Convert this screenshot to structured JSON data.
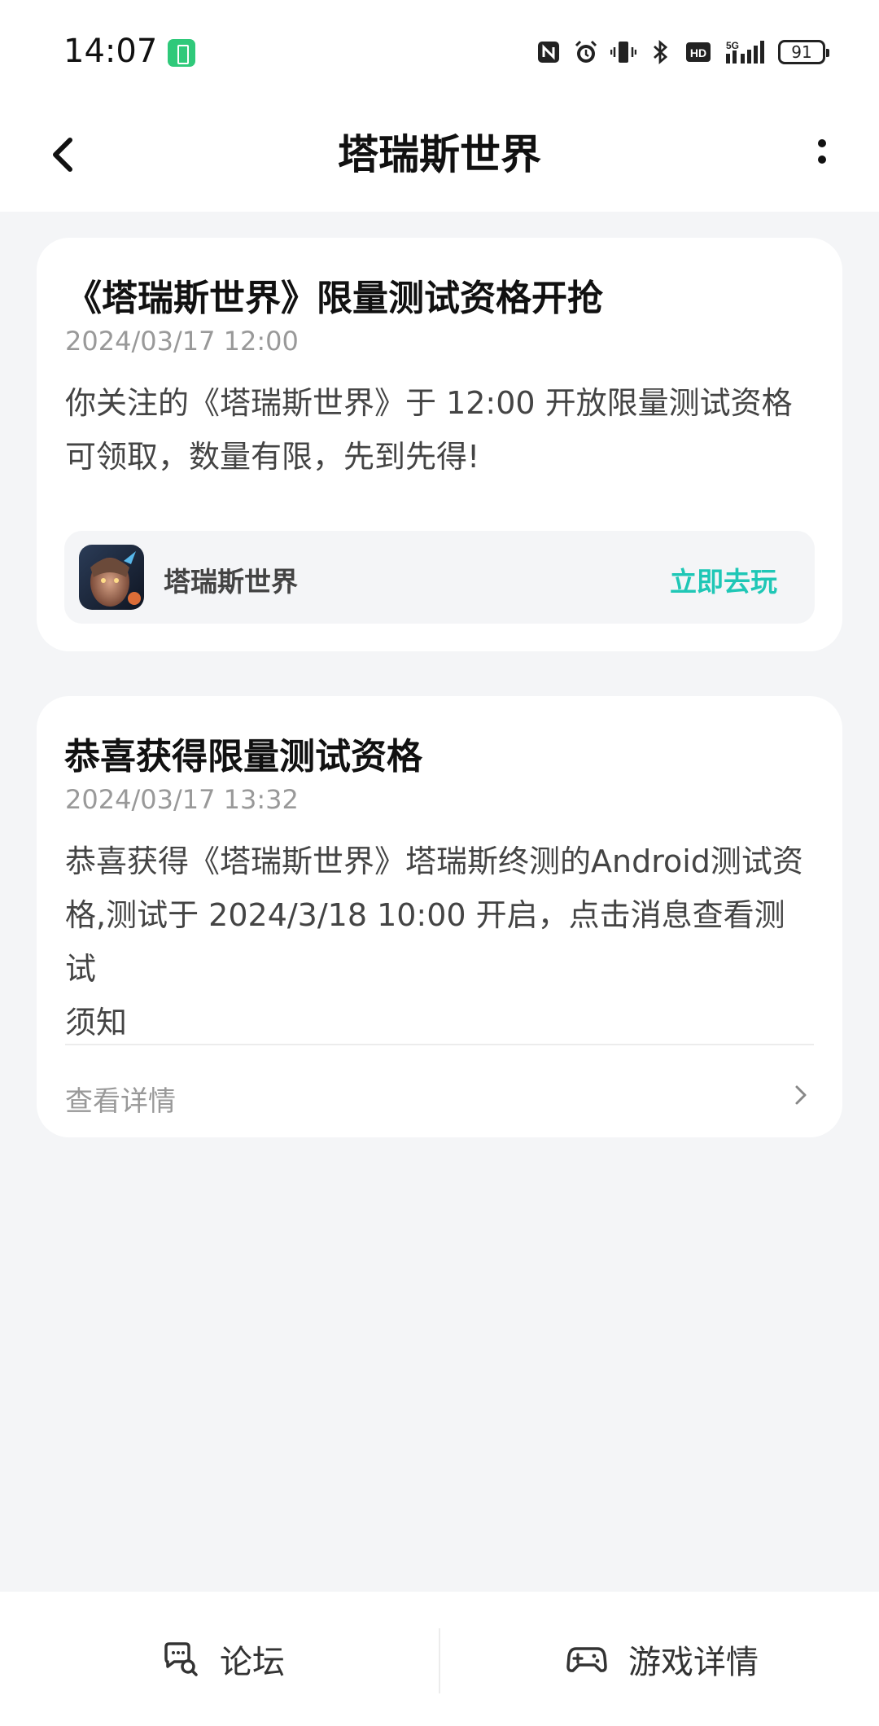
{
  "status_bar": {
    "time": "14:07",
    "battery_level": "91",
    "network": "5G",
    "icons": [
      "nfc-icon",
      "alarm-icon",
      "vibrate-icon",
      "bluetooth-icon",
      "hd-icon",
      "signal-icon",
      "battery-icon"
    ]
  },
  "header": {
    "title": "塔瑞斯世界",
    "icons": [
      "back-icon",
      "more-icon"
    ]
  },
  "messages": [
    {
      "title": "《塔瑞斯世界》限量测试资格开抢",
      "time": "2024/03/17 12:00",
      "body_line1": "你关注的《塔瑞斯世界》于 12:00 开放限量测试资格",
      "body_line2": "可领取，数量有限，先到先得!",
      "game": {
        "name": "塔瑞斯世界",
        "action": "立即去玩"
      }
    },
    {
      "title": "恭喜获得限量测试资格",
      "time": "2024/03/17 13:32",
      "body_line1": "恭喜获得《塔瑞斯世界》塔瑞斯终测的Android测试资",
      "body_line2": "格,测试于 2024/3/18 10:00 开启，点击消息查看测试",
      "body_line3": "须知",
      "link": "查看详情"
    }
  ],
  "bottom_bar": {
    "forum_label": "论坛",
    "game_detail_label": "游戏详情"
  },
  "colors": {
    "accent": "#1fc7b6",
    "background": "#f4f5f7",
    "battery_saver": "#2fc97a"
  }
}
